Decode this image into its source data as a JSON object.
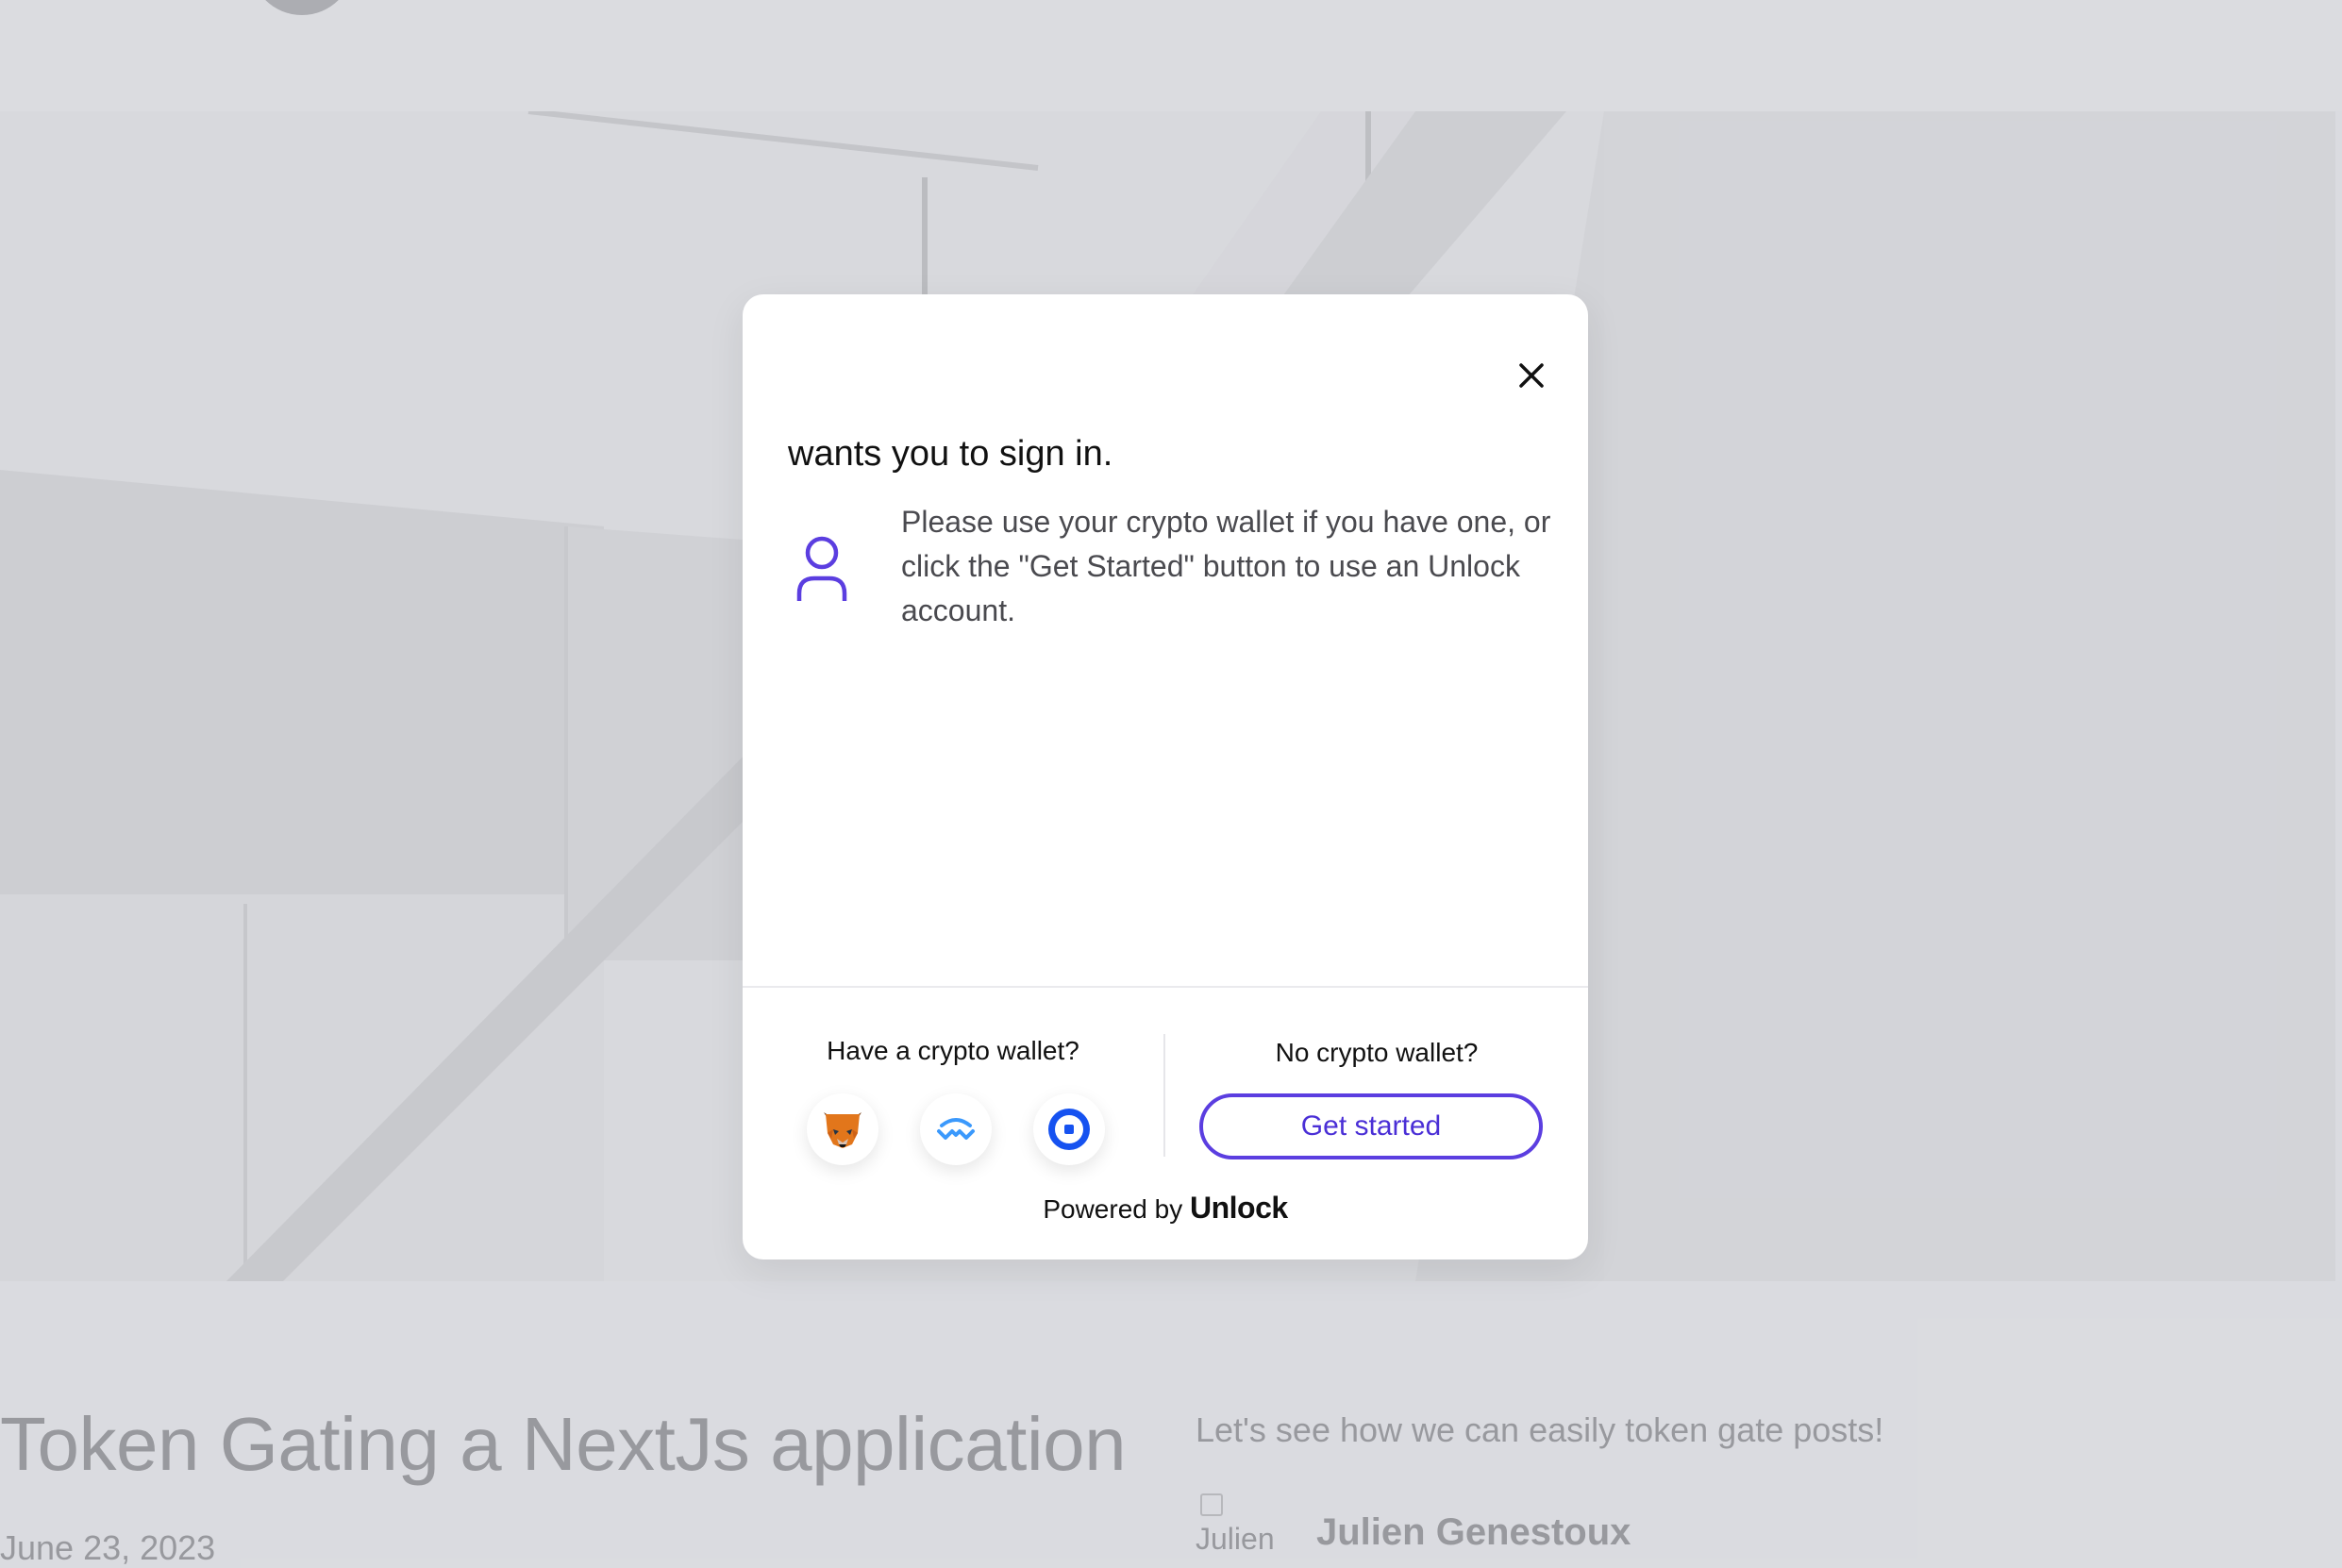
{
  "background_page": {
    "post": {
      "title": "Token Gating a NextJs application",
      "date": "June 23, 2023",
      "excerpt": "Let's see how we can easily token gate posts!",
      "author_avatar_alt": "Julien",
      "author_name": "Julien Genestoux"
    }
  },
  "modal": {
    "close_icon": "close-icon",
    "title": "wants you to sign in.",
    "user_icon": "user-icon",
    "description": "Please use your crypto wallet if you have one, or click the \"Get Started\" button to use an Unlock account.",
    "have_wallet_label": "Have a crypto wallet?",
    "wallets": [
      {
        "name": "MetaMask",
        "icon": "metamask-icon"
      },
      {
        "name": "WalletConnect",
        "icon": "walletconnect-icon"
      },
      {
        "name": "Coinbase Wallet",
        "icon": "coinbase-wallet-icon"
      }
    ],
    "no_wallet_label": "No crypto wallet?",
    "get_started_label": "Get started",
    "powered_by_prefix": "Powered by",
    "powered_by_brand": "Unlock"
  },
  "colors": {
    "accent": "#5b3ee0",
    "page_background": "#dfe0e4",
    "modal_background": "#ffffff"
  }
}
